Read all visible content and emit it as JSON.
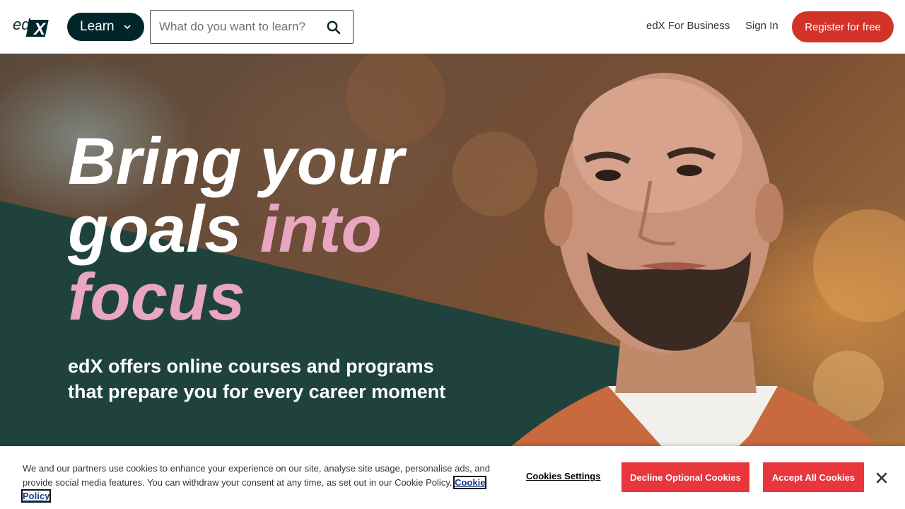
{
  "header": {
    "logo_text": "edX",
    "learn_label": "Learn",
    "search_placeholder": "What do you want to learn?",
    "business_label": "edX For Business",
    "signin_label": "Sign In",
    "register_label": "Register for free"
  },
  "hero": {
    "title_line1": "Bring your",
    "title_line2_plain": "goals ",
    "title_line2_accent": "into",
    "title_line3_accent": "focus",
    "subtitle": "edX offers online courses and programs that prepare you for every career moment"
  },
  "cookie_banner": {
    "text": "We and our partners use cookies to enhance your experience on our site, analyse site usage, personalise ads, and provide social media features. You can withdraw your consent at any time, as set out in our Cookie Policy. ",
    "policy_link": "Cookie Policy",
    "settings_label": "Cookies Settings",
    "decline_label": "Decline Optional Cookies",
    "accept_label": "Accept All Cookies"
  },
  "colors": {
    "brand_dark": "#00262b",
    "brand_red": "#d23228",
    "accent_pink": "#e8a6bf",
    "hero_teal": "#1f433c",
    "cookie_button": "#e8363c"
  },
  "icons": {
    "logo": "edx-logo",
    "learn_chevron": "chevron-down-icon",
    "search": "search-icon",
    "cookie_close": "close-icon"
  }
}
